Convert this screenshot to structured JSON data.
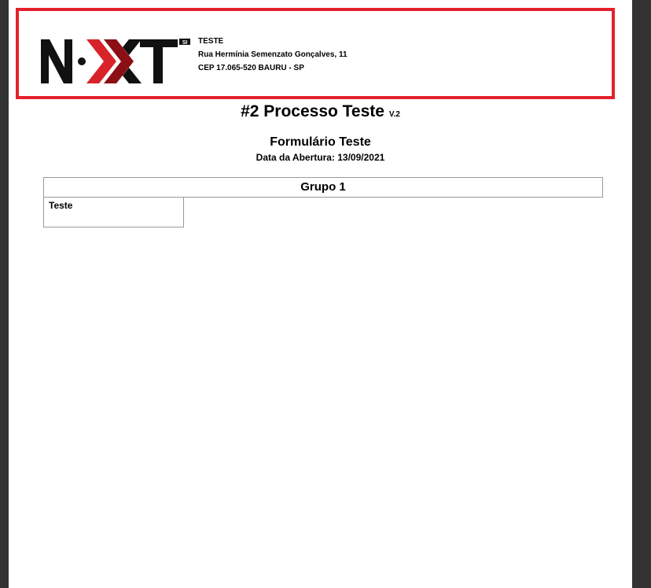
{
  "header": {
    "logo_text": "NXT",
    "logo_badge": "SI",
    "company_name": "TESTE",
    "address_line1": "Rua Hermínia Semenzato Gonçalves, 11",
    "address_line2": "CEP 17.065-520 BAURU - SP"
  },
  "document": {
    "title": "#2 Processo Teste",
    "version": "V.2",
    "form_title": "Formulário Teste",
    "open_date": "Data da Abertura: 13/09/2021"
  },
  "groups": [
    {
      "title": "Grupo 1",
      "fields": [
        {
          "label": "Teste",
          "value": ""
        }
      ]
    }
  ],
  "colors": {
    "border_accent": "#e4202a",
    "logo_red": "#d9232a",
    "logo_dark_red": "#8b0f14",
    "viewer_background": "#333333"
  }
}
